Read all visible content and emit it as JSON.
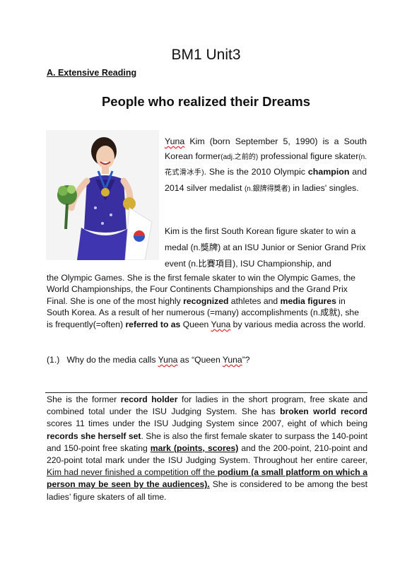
{
  "document": {
    "title": "BM1 Unit3",
    "section_label": "A. Extensive Reading",
    "heading": "People who realized their Dreams",
    "photo_alt": "Yuna Kim",
    "p1": {
      "name": "Yuna",
      "t1": " Kim (born September 5, 1990) is a South Korean former",
      "gloss_former": "(adj.之前的)",
      "t2": " professional figure skater",
      "gloss_skater": "(n.花式滑冰手)",
      "t3": ". She is the 2010 Olympic ",
      "b1": "champion",
      "t4": " and 2014 silver medalist ",
      "gloss_medalist": "(n.銀牌得獎者)",
      "t5": " in ladies' singles."
    },
    "p2": {
      "t1": "Kim is the first South Korean figure skater to win a medal (n.獎牌) at an ISU Junior or Senior Grand Prix event (n.比賽項目), ISU Championship, and",
      "t2": "the Olympic Games. She is the first female skater to win the Olympic Games, the World Championships, the Four Continents Championships and the Grand Prix Final. She is one of the most highly ",
      "b1": "recognized",
      "t3": " athletes and ",
      "b2": "media figures",
      "t4": " in South Korea. As a result of her numerous (=many) accomplishments (n.成就), she is frequently(=often) ",
      "b3": "referred to as",
      "t5": " Queen ",
      "name": "Yuna",
      "t6": " by various media across the world."
    },
    "question": {
      "num": "(1.)",
      "t1": "Why do the media calls ",
      "name1": "Yuna",
      "t2": " as “Queen ",
      "name2": "Yuna",
      "t3": "”?"
    },
    "p3": {
      "t1": "She is the former ",
      "b1": "record holder",
      "t2": " for ladies in the short program, free skate and combined total under the ISU Judging System. She has ",
      "b2": "broken world record",
      "t3": " scores 11 times under the ISU Judging System since 2007, eight of which being ",
      "b3": "records she herself set",
      "t4": ". She is also the first female skater to surpass the 140-point and 150-point free skating ",
      "bu1": "mark (points, scores)",
      "t5": " and the 200-point, 210-point and 220-point total mark under the ISU Judging System. Throughout her entire career, ",
      "u1": "Kim had never finished a competition off the ",
      "bu2": "podium (a small platform on which a person may be seen by the audiences).",
      "t6": " She is considered to be among the best ladies’ figure skaters of all time."
    }
  }
}
